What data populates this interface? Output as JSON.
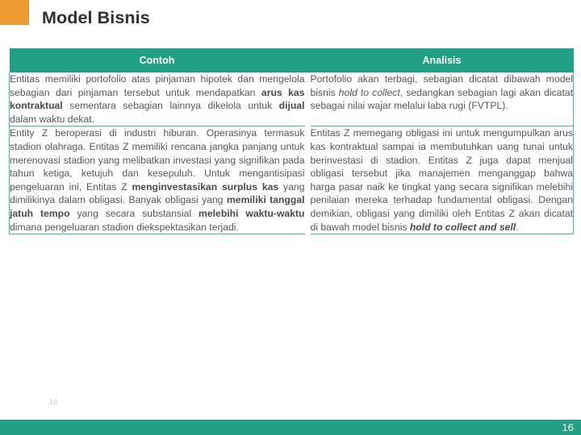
{
  "slide": {
    "title": "Model Bisnis",
    "accent_orange": "#ED9B33",
    "accent_teal": "#22A085",
    "border_teal": "#4FB79E",
    "text_gray": "#575757",
    "page_number_faint": "16",
    "page_number_bar": "16"
  },
  "table": {
    "headers": [
      {
        "label": "Contoh"
      },
      {
        "label": "Analisis"
      }
    ],
    "rows": [
      {
        "contoh_html": "Entitas memiliki portofolio atas pinjaman hipotek dan mengelola sebagian dari pinjaman tersebut untuk mendapatkan <b>arus kas kontraktual</b> sementara sebagian lainnya dikelola untuk <b>dijual</b> dalam waktu dekat.",
        "contoh_text": "Entitas memiliki portofolio atas pinjaman hipotek dan mengelola sebagian dari pinjaman tersebut untuk mendapatkan arus kas kontraktual sementara sebagian lainnya dikelola untuk dijual dalam waktu dekat.",
        "analisis_html": "Portofolio akan terbagi, sebagian dicatat dibawah model bisnis <i>hold to collect</i>, sedangkan sebagian lagi akan dicatat sebagai nilai wajar melalui laba rugi (FVTPL).",
        "analisis_text": "Portofolio akan terbagi, sebagian dicatat dibawah model bisnis hold to collect, sedangkan sebagian lagi akan dicatat sebagai nilai wajar melalui laba rugi (FVTPL)."
      },
      {
        "contoh_html": "Entity Z beroperasi di industri hiburan. Operasinya termasuk stadion olahraga. Entitas Z memiliki rencana jangka panjang untuk merenovasi stadion yang melibatkan investasi yang signifikan pada tahun ketiga, ketujuh dan kesepuluh. Untuk mengantisipasi pengeluaran ini, Entitas Z <b>menginvestasikan surplus kas</b> yang dimilikinya dalam obligasi. Banyak obligasi yang <b>memiliki tanggal jatuh tempo</b> yang secara substansial <b>melebihi waktu-waktu</b> dimana pengeluaran stadion diekspektasikan terjadi.",
        "contoh_text": "Entity Z beroperasi di industri hiburan. Operasinya termasuk stadion olahraga. Entitas Z memiliki rencana jangka panjang untuk merenovasi stadion yang melibatkan investasi yang signifikan pada tahun ketiga, ketujuh dan kesepuluh. Untuk mengantisipasi pengeluaran ini, Entitas Z menginvestasikan surplus kas yang dimilikinya dalam obligasi. Banyak obligasi yang memiliki tanggal jatuh tempo yang secara substansial melebihi waktu-waktu dimana pengeluaran stadion diekspektasikan terjadi.",
        "analisis_html": "Entitas Z memegang obligasi ini untuk mengumpulkan arus kas kontraktual sampai ia membutuhkan uang tunai untuk berinvestasi di stadion. Entitas Z juga dapat menjual obligasi tersebut jika manajemen menganggap bahwa harga pasar naik ke tingkat yang secara signifikan melebihi penilaian mereka terhadap fundamental obligasi. Dengan demikian, obligasi yang dimiliki oleh Entitas Z akan dicatat di bawah model bisnis <span class=\"bi\">hold to collect and sell</span>.",
        "analisis_text": "Entitas Z memegang obligasi ini untuk mengumpulkan arus kas kontraktual sampai ia membutuhkan uang tunai untuk berinvestasi di stadion. Entitas Z juga dapat menjual obligasi tersebut jika manajemen menganggap bahwa harga pasar naik ke tingkat yang secara signifikan melebihi penilaian mereka terhadap fundamental obligasi. Dengan demikian, obligasi yang dimiliki oleh Entitas Z akan dicatat di bawah model bisnis hold to collect and sell."
      }
    ]
  }
}
